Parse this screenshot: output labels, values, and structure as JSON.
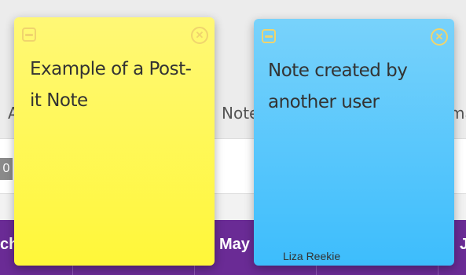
{
  "background": {
    "header_left": "A",
    "header_mid": "Note",
    "header_right": "ma",
    "badge": "0",
    "bar_left": "ch",
    "bar_mid": "May",
    "bar_right": "J"
  },
  "notes": [
    {
      "text": "Example of a Post-it Note",
      "color": "#fff739",
      "author": ""
    },
    {
      "text": "Note created by another user",
      "color": "#3dbdfc",
      "author": "Liza Reekie"
    }
  ],
  "icons": {
    "minimize": "minimize-icon",
    "close": "close-icon"
  }
}
